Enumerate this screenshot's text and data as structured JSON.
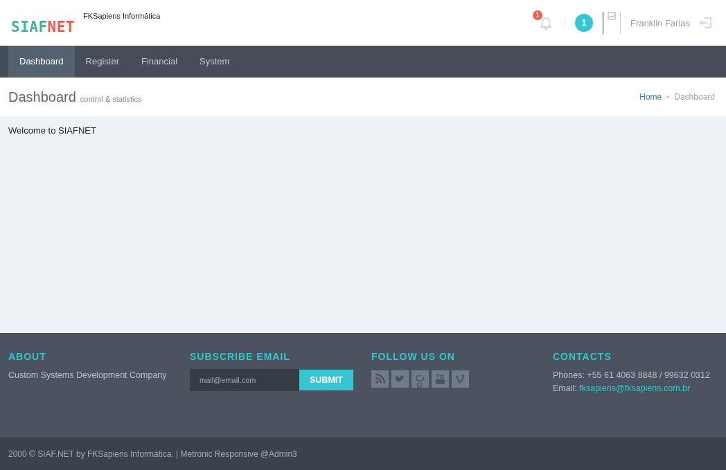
{
  "header": {
    "logo": {
      "part_1": "SIAF",
      "part_2": "NET"
    },
    "company": "FKSapiens Informática",
    "notifications_badge": "1",
    "messages_badge": "1",
    "user_name": "Franklin Farias"
  },
  "nav": [
    {
      "label": "Dashboard",
      "selected": true
    },
    {
      "label": "Register",
      "selected": false
    },
    {
      "label": "Financial",
      "selected": false
    },
    {
      "label": "System",
      "selected": false
    }
  ],
  "page_title": {
    "title": "Dashboard",
    "subtitle": "control & statistics"
  },
  "breadcrumb": [
    {
      "label": "Home",
      "selected": false
    },
    {
      "label": "Dashboard",
      "selected": true
    }
  ],
  "content": {
    "welcome": "Welcome to SIAFNET"
  },
  "footer": {
    "about": {
      "heading": "ABOUT",
      "text": "Custom Systems Development Company"
    },
    "subscribe": {
      "heading": "SUBSCRIBE EMAIL",
      "placeholder": "mail@email.com",
      "button": "SUBMIT"
    },
    "follow": {
      "heading": "FOLLOW US ON"
    },
    "contacts": {
      "heading": "CONTACTS",
      "phones": "Phones: +55 61 4063 8848 / 99632 0312",
      "email_label": "Email:",
      "email": "fksapiens@fksapiens.com.br"
    }
  },
  "copyright": "2000 © SIAF.NET by FKSapiens Informática. | Metronic Responsive @Admin3"
}
